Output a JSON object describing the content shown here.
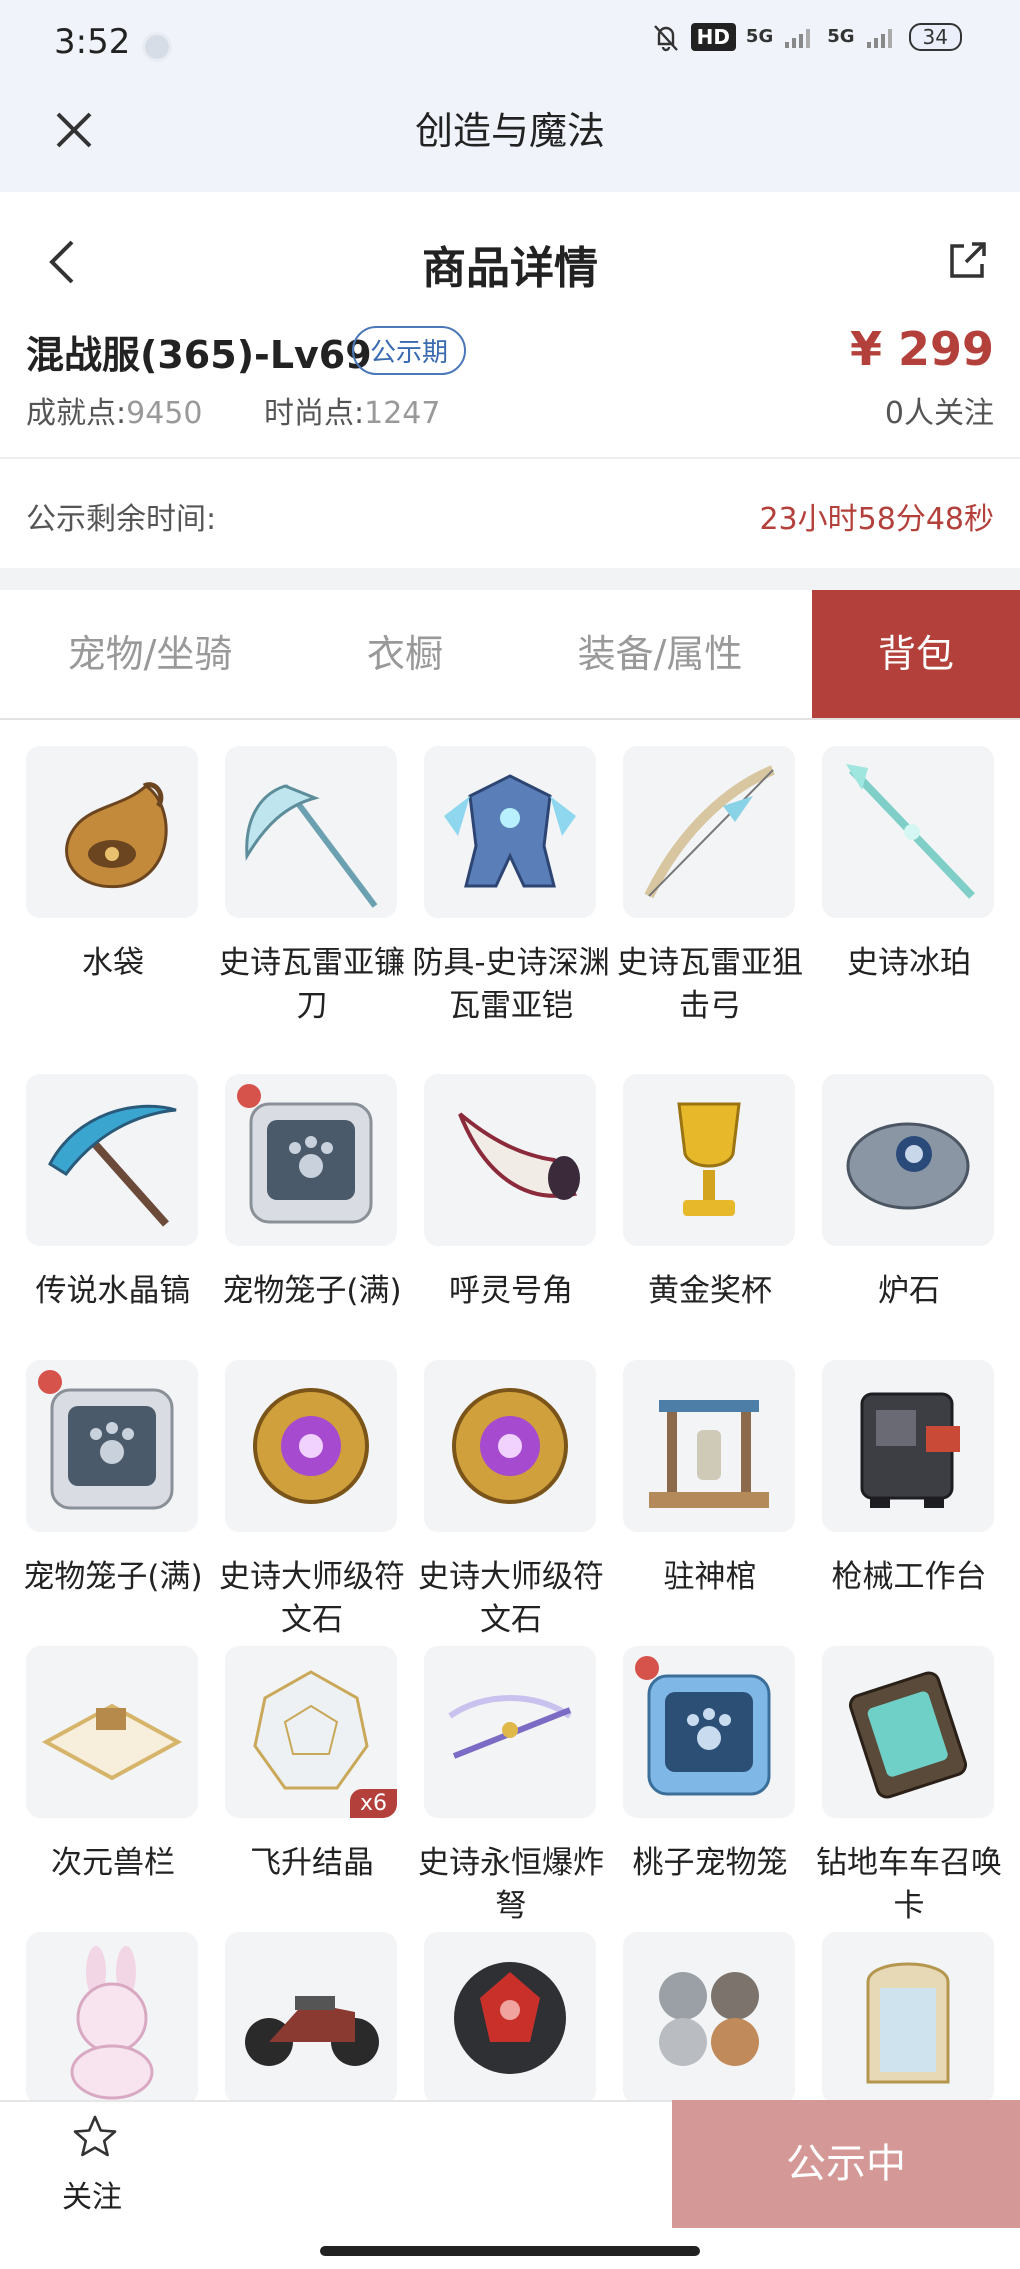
{
  "status_bar": {
    "time": "3:52",
    "hd": "HD",
    "net1": "5G",
    "net2": "5G",
    "battery": "34"
  },
  "app_bar": {
    "title": "创造与魔法"
  },
  "page_header": {
    "title": "商品详情"
  },
  "product": {
    "name": "混战服(365)-Lv69",
    "badge": "公示期",
    "price": "¥ 299",
    "achievement_label": "成就点:",
    "achievement_value": "9450",
    "fashion_label": "时尚点:",
    "fashion_value": "1247",
    "followers": "0人关注"
  },
  "countdown": {
    "label": "公示剩余时间:",
    "value": "23小时58分48秒"
  },
  "tabs": [
    {
      "label": "宠物/坐骑"
    },
    {
      "label": "衣橱"
    },
    {
      "label": "装备/属性"
    },
    {
      "label": "背包"
    }
  ],
  "items": [
    {
      "name": "水袋",
      "icon": "water-bag-icon"
    },
    {
      "name": "史诗瓦雷亚镰刀",
      "icon": "scythe-icon"
    },
    {
      "name": "防具-史诗深渊瓦雷亚铠",
      "icon": "armor-icon"
    },
    {
      "name": "史诗瓦雷亚狙击弓",
      "icon": "bow-icon"
    },
    {
      "name": "史诗冰珀",
      "icon": "ice-staff-icon"
    },
    {
      "name": "传说水晶镐",
      "icon": "pickaxe-icon"
    },
    {
      "name": "宠物笼子(满)",
      "icon": "pet-cage-icon"
    },
    {
      "name": "呼灵号角",
      "icon": "horn-icon"
    },
    {
      "name": "黄金奖杯",
      "icon": "trophy-icon"
    },
    {
      "name": "炉石",
      "icon": "hearthstone-icon"
    },
    {
      "name": "宠物笼子(满)",
      "icon": "pet-cage-icon"
    },
    {
      "name": "史诗大师级符文石",
      "icon": "rune-stone-icon"
    },
    {
      "name": "史诗大师级符文石",
      "icon": "rune-stone-icon"
    },
    {
      "name": "驻神棺",
      "icon": "shrine-icon"
    },
    {
      "name": "枪械工作台",
      "icon": "workbench-icon"
    },
    {
      "name": "次元兽栏",
      "icon": "fence-icon"
    },
    {
      "name": "飞升结晶",
      "icon": "crystal-icon",
      "qty": "x6"
    },
    {
      "name": "史诗永恒爆炸弩",
      "icon": "crossbow-icon"
    },
    {
      "name": "桃子宠物笼",
      "icon": "peach-pet-cage-icon"
    },
    {
      "name": "钻地车车召唤卡",
      "icon": "summon-card-icon"
    },
    {
      "name": "",
      "icon": "bunny-icon"
    },
    {
      "name": "",
      "icon": "motorcycle-icon"
    },
    {
      "name": "",
      "icon": "red-gem-icon"
    },
    {
      "name": "",
      "icon": "cats-icon"
    },
    {
      "name": "",
      "icon": "mirror-cabinet-icon"
    }
  ],
  "bottom_bar": {
    "follow_label": "关注",
    "cta_label": "公示中"
  },
  "colors": {
    "accent": "#b3403a",
    "cta_disabled": "#d49896",
    "badge_blue": "#4a78b8"
  }
}
